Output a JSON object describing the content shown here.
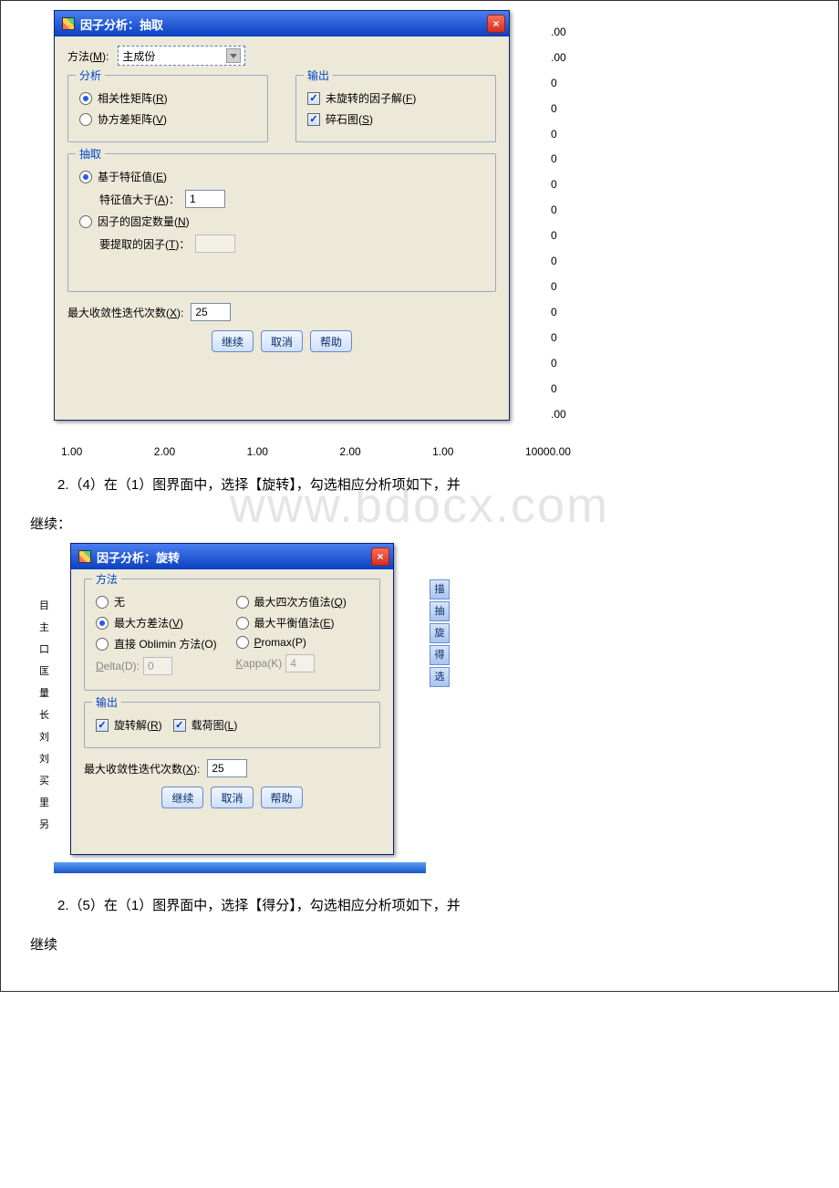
{
  "dialog1": {
    "title": "因子分析：抽取",
    "method_label": "方法(M):",
    "method_value": "主成份",
    "group_analysis": {
      "label": "分析",
      "opt_corr": "相关性矩阵(R)",
      "opt_cov": "协方差矩阵(V)"
    },
    "group_output": {
      "label": "输出",
      "chk_unrotated": "未旋转的因子解(F)",
      "chk_scree": "碎石图(S)"
    },
    "group_extract": {
      "label": "抽取",
      "opt_eigen": "基于特征值(E)",
      "eigen_gt_label": "特征值大于(A)：",
      "eigen_gt_value": "1",
      "opt_fixed": "因子的固定数量(N)",
      "fixed_label": "要提取的因子(T)：",
      "fixed_value": ""
    },
    "converge_label": "最大收敛性迭代次数(X):",
    "converge_value": "25",
    "btn_continue": "继续",
    "btn_cancel": "取消",
    "btn_help": "帮助"
  },
  "bg1": {
    "right_col": [
      ".00",
      ".00",
      "0",
      "0",
      "0",
      "0",
      "0",
      "0",
      "0",
      "0",
      "0",
      "0",
      "0",
      "0",
      "0",
      ".00"
    ],
    "axis": [
      "1.00",
      "2.00",
      "1.00",
      "2.00",
      "1.00",
      "10000.00"
    ]
  },
  "para1_a": "2.（4）在（1）图界面中，选择【旋转】，勾选相应分析项如下，并",
  "para1_b": "继续：",
  "watermark": "www.bdocx.com",
  "dialog2": {
    "title": "因子分析：旋转",
    "group_method": {
      "label": "方法",
      "opt_none": "无",
      "opt_varimax": "最大方差法(V)",
      "opt_oblimin": "直接 Oblimin 方法(O)",
      "delta_label": "Delta(D):",
      "delta_value": "0",
      "opt_quartimax": "最大四次方值法(Q)",
      "opt_equamax": "最大平衡值法(E)",
      "opt_promax": "Promax(P)",
      "kappa_label": "Kappa(K)",
      "kappa_value": "4"
    },
    "group_output": {
      "label": "输出",
      "chk_rotsol": "旋转解(R)",
      "chk_loading": "载荷图(L)"
    },
    "converge_label": "最大收敛性迭代次数(X):",
    "converge_value": "25",
    "btn_continue": "继续",
    "btn_cancel": "取消",
    "btn_help": "帮助"
  },
  "bg2": {
    "side_buttons": [
      "描",
      "抽",
      "旋",
      "得",
      "选"
    ],
    "left_trunc": [
      "目",
      "主",
      "口",
      "匡",
      "量",
      "长",
      "刘",
      "刘",
      "买",
      "里",
      "另"
    ]
  },
  "para2_a": "2.（5）在（1）图界面中，选择【得分】，勾选相应分析项如下，并",
  "para2_b": "继续"
}
